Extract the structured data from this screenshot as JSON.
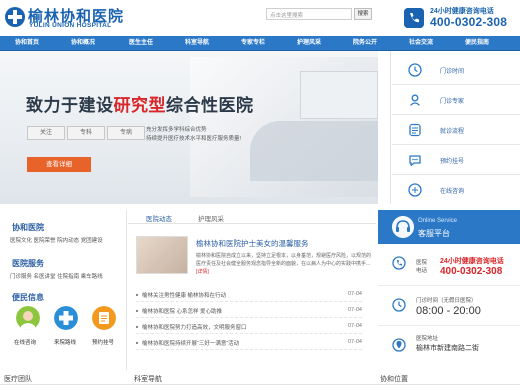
{
  "header": {
    "logo_cn": "榆林协和医院",
    "logo_en": "YULIN UNION HOSPITAL",
    "search_placeholder": "点击这里搜索",
    "search_button": "搜索",
    "phone_label": "24小时健康咨询电话",
    "phone_number": "400-0302-308"
  },
  "nav": {
    "items": [
      "协和首页",
      "协和概况",
      "医生主任",
      "科室导航",
      "专家专栏",
      "护理风采",
      "院务公开",
      "社会交流",
      "便民指南"
    ]
  },
  "banner": {
    "title_pre": "致力于建设",
    "title_highlight": "研究型",
    "title_post": "综合性医院",
    "tags": [
      "关注",
      "专科",
      "专病"
    ],
    "desc_line1": "充分发挥多学科综合优势",
    "desc_line2": "持续提升医疗技术水平和医疗服务质量!",
    "button": "查看详细"
  },
  "quick_menu": {
    "items": [
      "门诊时间",
      "门诊专家",
      "就诊流程",
      "预约挂号",
      "在线咨询"
    ],
    "icons": [
      "clock-icon",
      "doctor-icon",
      "process-icon",
      "appointment-icon",
      "chat-icon"
    ]
  },
  "left": {
    "section1_title": "协和医院",
    "section1_links": [
      "医院文化",
      "医院荣誉",
      "院内动态",
      "党团建设"
    ],
    "section2_title": "医院服务",
    "section2_links": [
      "门诊服务",
      "名医讲堂",
      "住院指南",
      "乘车路线"
    ],
    "section3_title": "便民信息",
    "shortcuts": [
      "在线咨询",
      "来院路线",
      "预约挂号"
    ]
  },
  "news": {
    "tabs": [
      "医院动态",
      "护理风采"
    ],
    "feature_title": "榆林协和医院护士美女的温馨服务",
    "feature_desc": "榆林协和医院自成立以来，坚持立足根本，以身垂范，规避医疗风险，以规范的医疗责任及社会健全服务观念指导全新的面貌，在以病人为中心的实践中携手...",
    "feature_more": "[详情]",
    "items": [
      {
        "title": "榆林关注男性健康 榆林协和在行动",
        "date": "07-04"
      },
      {
        "title": "榆林协和医院 心系怎样 爱心助推",
        "date": "07-04"
      },
      {
        "title": "榆林协和医院努力打造高效，文明服务窗口",
        "date": "07-04"
      },
      {
        "title": "榆林协和医院持续开展“三好一满意”活动",
        "date": "07-04"
      }
    ]
  },
  "service": {
    "en": "Online Service",
    "cn": "客服平台",
    "phone_label1": "医院",
    "phone_label2": "电话",
    "phone_title": "24小时健康咨询电话",
    "phone_number": "400-0302-308",
    "hours_label": "门诊时间（无假日医院）",
    "hours": "08:00 - 20:00",
    "addr_label": "医院地址",
    "addr": "榆林市新建南路二街"
  },
  "bottom": {
    "headers": [
      "医疗团队",
      "科室导航",
      "协和位置"
    ]
  },
  "colors": {
    "brand_blue": "#2b78c7",
    "accent_red": "#d8262a",
    "button_orange": "#e8632a"
  }
}
